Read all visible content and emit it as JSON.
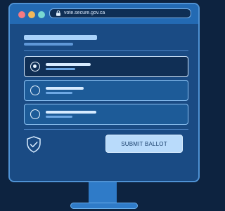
{
  "browser": {
    "url": "vote.secure.gov.ca"
  },
  "ballot": {
    "options": [
      {
        "selected": true
      },
      {
        "selected": false
      },
      {
        "selected": false
      }
    ],
    "submit_label": "SUBMIT BALLOT"
  },
  "icons": {
    "lock": "lock-icon",
    "shield": "shield-check-icon"
  },
  "colors": {
    "background": "#0d2340",
    "screen": "#1a4b84",
    "accent": "#4f92d4",
    "button": "#b9dbfb"
  }
}
